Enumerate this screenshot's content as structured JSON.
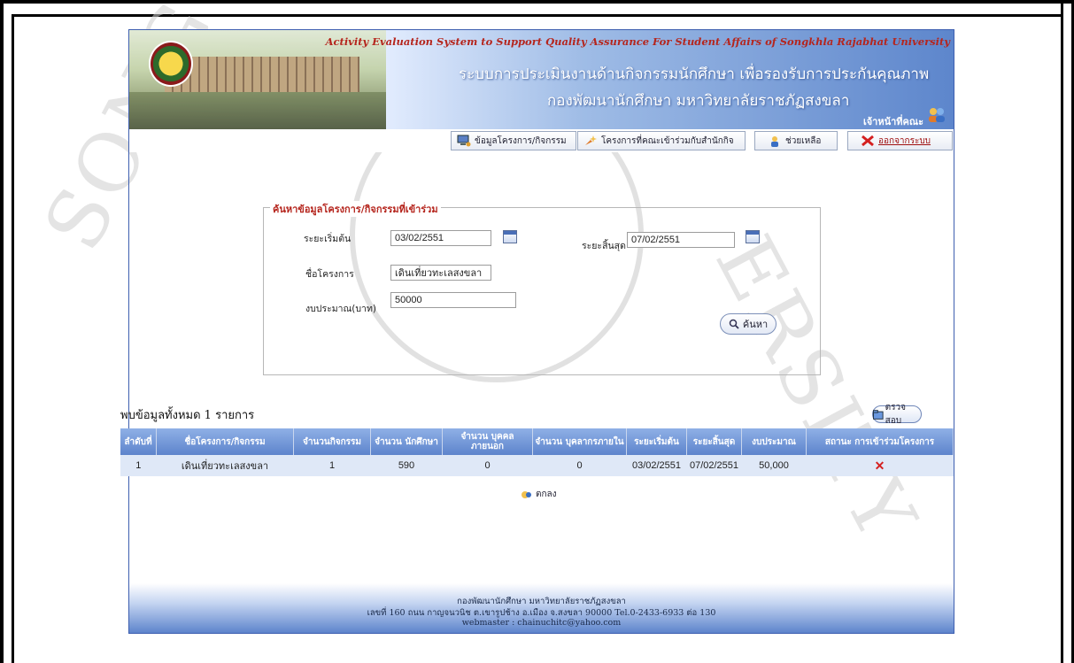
{
  "banner": {
    "english_title": "Activity Evaluation System to Support Quality Assurance For Student Affairs of Songkhla Rajabhat University",
    "thai_title_line1": "ระบบการประเมินงานด้านกิจกรรมนักศึกษา   เพื่อรองรับการประกันคุณภาพ",
    "thai_title_line2": "กองพัฒนานักศึกษา   มหาวิทยาลัยราชภัฏสงขลา",
    "officer_label": "เจ้าหน้าที่คณะ"
  },
  "menu": {
    "items": [
      {
        "label": "ข้อมูลโครงการ/กิจกรรม",
        "icon": "computer-icon"
      },
      {
        "label": "โครงการที่คณะเข้าร่วมกับสำนักกิจ",
        "icon": "sparkle-icon"
      },
      {
        "label": "ช่วยเหลือ",
        "icon": "help-icon"
      },
      {
        "label": "ออกจากระบบ",
        "icon": "close-icon"
      }
    ]
  },
  "search": {
    "legend": "ค้นหาข้อมูลโครงการ/กิจกรรมที่เข้าร่วม",
    "start_label": "ระยะเริ่มต้น",
    "start_value": "03/02/2551",
    "end_label": "ระยะสิ้นสุด",
    "end_value": "07/02/2551",
    "project_label": "ชื่อโครงการ",
    "project_value": "เดินเที่ยวทะเลสงขลา",
    "budget_label": "งบประมาณ(บาท)",
    "budget_value": "50000",
    "search_button": "ค้นหา"
  },
  "results": {
    "summary": "พบข้อมูลทั้งหมด 1 รายการ",
    "check_button": "ตรวจสอบ",
    "columns": [
      "ลำดับที่",
      "ชื่อโครงการ/กิจกรรม",
      "จำนวนกิจกรรม",
      "จำนวน นักศึกษา",
      "จำนวน บุคคลภายนอก",
      "จำนวน บุคลากรภายใน",
      "ระยะเริ่มต้น",
      "ระยะสิ้นสุด",
      "งบประมาณ",
      "สถานะ การเข้าร่วมโครงการ"
    ],
    "rows": [
      {
        "no": "1",
        "name": "เดินเที่ยวทะเลสงขลา",
        "activities": "1",
        "students": "590",
        "outsiders": "0",
        "staff": "0",
        "start": "03/02/2551",
        "end": "07/02/2551",
        "budget": "50,000",
        "status_icon": "red-x-icon"
      }
    ],
    "ok_label": "ตกลง"
  },
  "footer": {
    "line1": "กองพัฒนานักศึกษา มหาวิทยาลัยราชภัฏสงขลา",
    "line2": "เลขที่ 160 ถนน กาญจนวนิช ต.เขารูปช้าง อ.เมือง จ.สงขลา 90000 Tel.0-2433-6933 ต่อ 130",
    "line3": "webmaster : chainuchitc@yahoo.com"
  },
  "watermark": {
    "text_left": "SONG",
    "text_right": "ERSITY"
  },
  "colors": {
    "accent": "#5d84cc",
    "title_red": "#b5251d",
    "row_bg": "#dfe8f7"
  }
}
